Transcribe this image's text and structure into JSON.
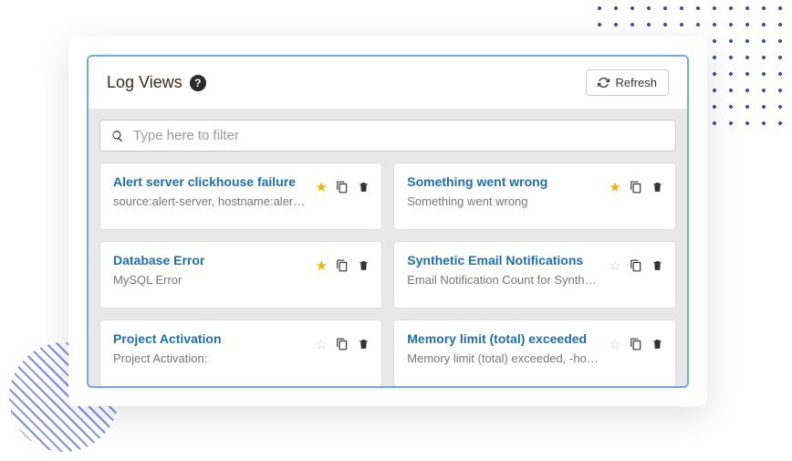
{
  "header": {
    "title": "Log Views",
    "help_tooltip": "?",
    "refresh_label": "Refresh"
  },
  "filter": {
    "placeholder": "Type here to filter",
    "value": ""
  },
  "views": [
    {
      "title": "Alert server clickhouse failure",
      "desc": "source:alert-server, hostname:aler…",
      "starred": true
    },
    {
      "title": "Something went wrong",
      "desc": "Something went wrong",
      "starred": true
    },
    {
      "title": "Database Error",
      "desc": "MySQL Error",
      "starred": true
    },
    {
      "title": "Synthetic Email Notifications",
      "desc": "Email Notification Count for Synth…",
      "starred": false
    },
    {
      "title": "Project Activation",
      "desc": "Project Activation:",
      "starred": false
    },
    {
      "title": "Memory limit (total) exceeded",
      "desc": "Memory limit (total) exceeded, -ho…",
      "starred": false
    }
  ]
}
